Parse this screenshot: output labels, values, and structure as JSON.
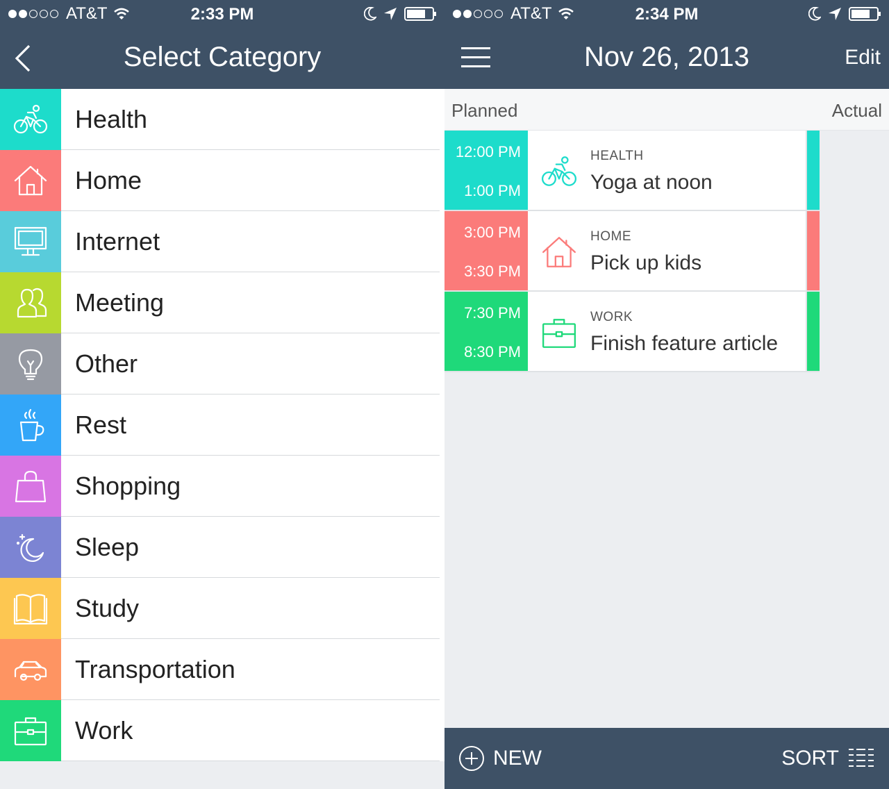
{
  "left": {
    "status_bar": {
      "carrier": "AT&T",
      "time": "2:33 PM"
    },
    "title": "Select Category",
    "categories": [
      {
        "label": "Health",
        "icon": "bicycle-icon",
        "color": "#1ddccb"
      },
      {
        "label": "Home",
        "icon": "house-icon",
        "color": "#fb7b7a"
      },
      {
        "label": "Internet",
        "icon": "monitor-icon",
        "color": "#59ccdb"
      },
      {
        "label": "Meeting",
        "icon": "people-icon",
        "color": "#b7d930"
      },
      {
        "label": "Other",
        "icon": "lightbulb-icon",
        "color": "#969aa3"
      },
      {
        "label": "Rest",
        "icon": "coffee-cup-icon",
        "color": "#33a6f8"
      },
      {
        "label": "Shopping",
        "icon": "shopping-bag-icon",
        "color": "#d875e3"
      },
      {
        "label": "Sleep",
        "icon": "moon-icon",
        "color": "#7c84d3"
      },
      {
        "label": "Study",
        "icon": "book-icon",
        "color": "#fdc751"
      },
      {
        "label": "Transportation",
        "icon": "car-icon",
        "color": "#fe9462"
      },
      {
        "label": "Work",
        "icon": "briefcase-icon",
        "color": "#1fd97a"
      }
    ]
  },
  "right": {
    "status_bar": {
      "carrier": "AT&T",
      "time": "2:34 PM"
    },
    "title": "Nov 26, 2013",
    "edit_label": "Edit",
    "columns": {
      "planned": "Planned",
      "actual": "Actual"
    },
    "events": [
      {
        "start": "12:00 PM",
        "end": "1:00 PM",
        "category": "HEALTH",
        "title": "Yoga at noon",
        "icon": "bicycle-icon",
        "color": "#1ddccb"
      },
      {
        "start": "3:00 PM",
        "end": "3:30 PM",
        "category": "HOME",
        "title": "Pick up kids",
        "icon": "house-icon",
        "color": "#fb7b7a"
      },
      {
        "start": "7:30 PM",
        "end": "8:30 PM",
        "category": "WORK",
        "title": "Finish feature article",
        "icon": "briefcase-icon",
        "color": "#1fd97a"
      }
    ],
    "footer": {
      "new_label": "NEW",
      "sort_label": "SORT"
    }
  }
}
